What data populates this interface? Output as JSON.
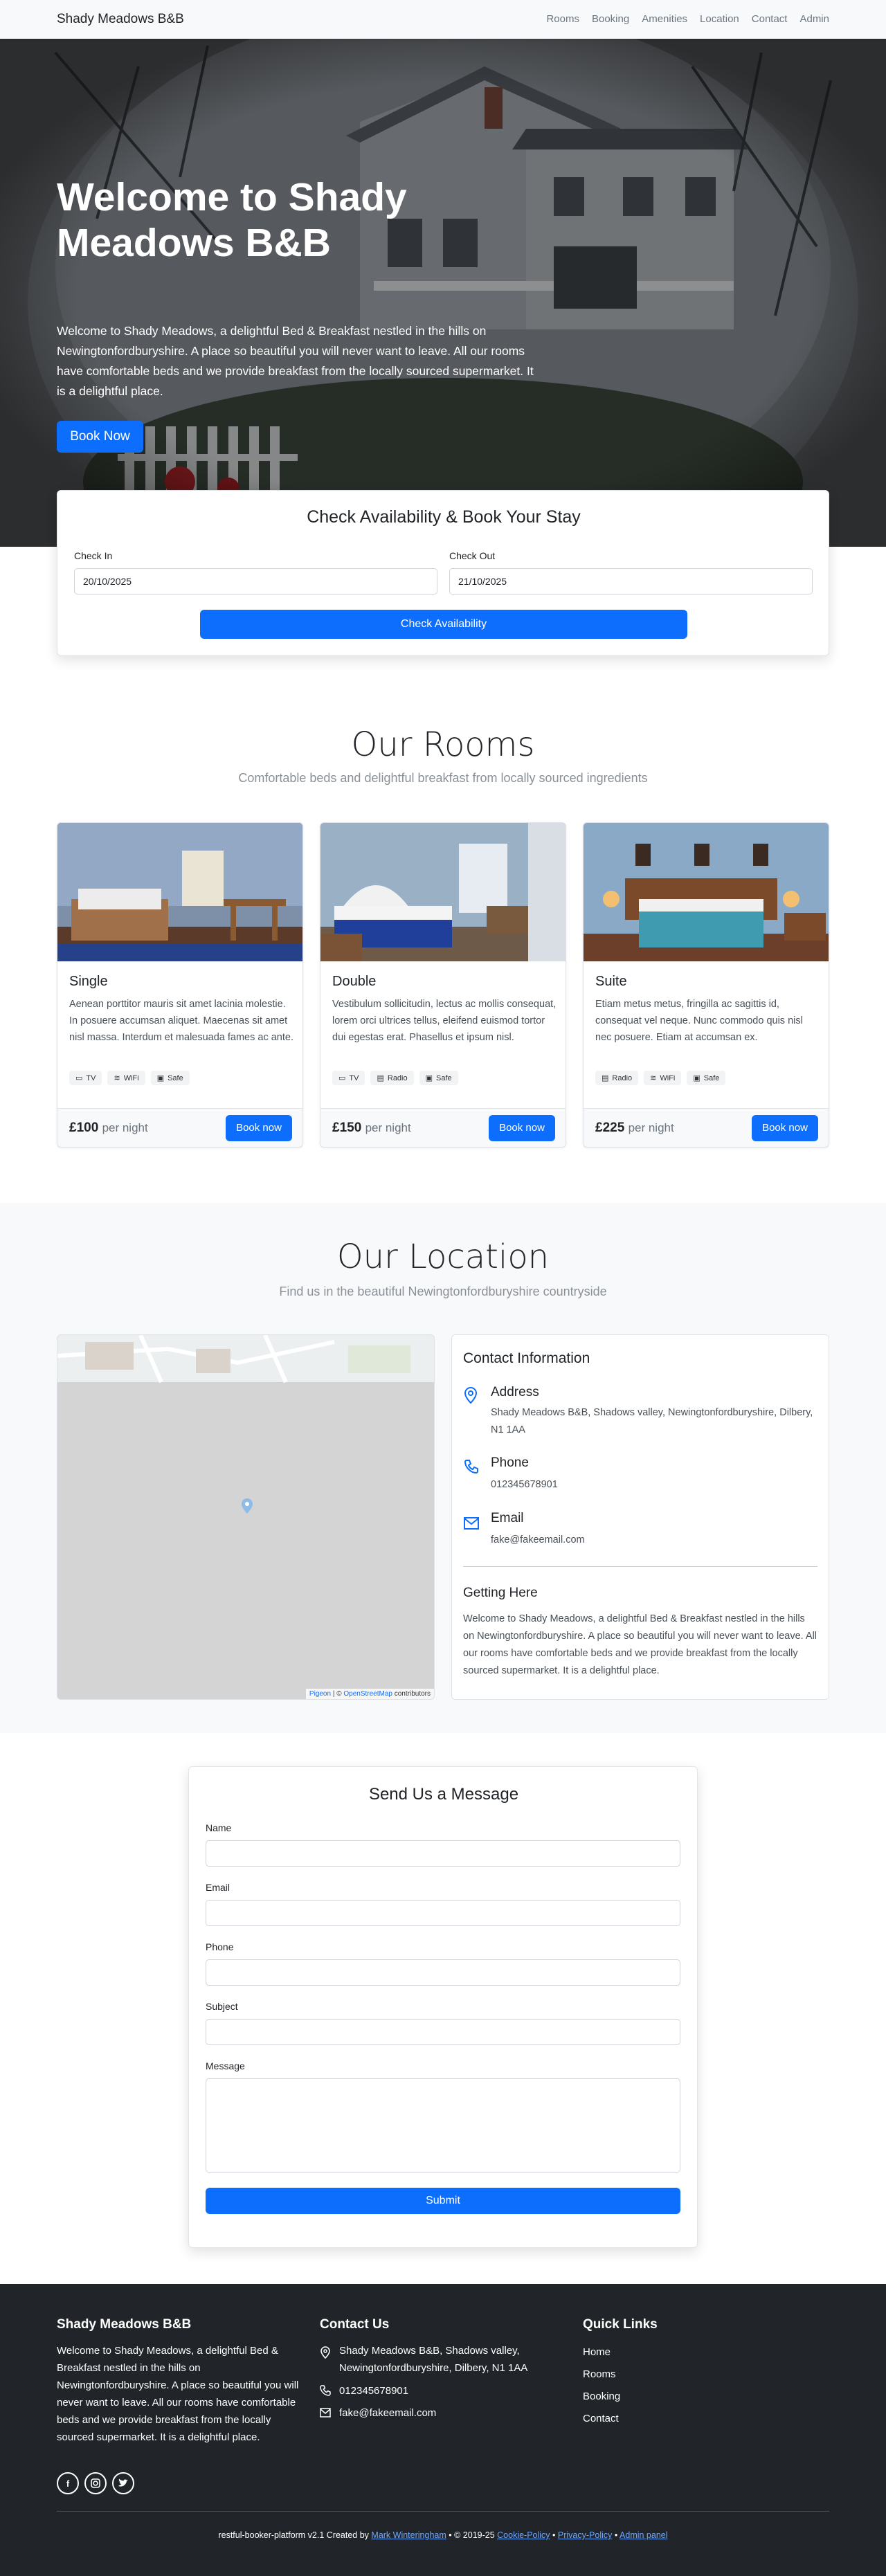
{
  "nav": {
    "brand": "Shady Meadows B&B",
    "links": [
      "Rooms",
      "Booking",
      "Amenities",
      "Location",
      "Contact",
      "Admin"
    ]
  },
  "hero": {
    "title": "Welcome to Shady Meadows B&B",
    "text": "Welcome to Shady Meadows, a delightful Bed & Breakfast nestled in the hills on Newingtonfordburyshire. A place so beautiful you will never want to leave. All our rooms have comfortable beds and we provide breakfast from the locally sourced supermarket. It is a delightful place.",
    "button": "Book Now"
  },
  "booking": {
    "title": "Check Availability & Book Your Stay",
    "checkin_label": "Check In",
    "checkin_value": "20/10/2025",
    "checkout_label": "Check Out",
    "checkout_value": "21/10/2025",
    "button": "Check Availability"
  },
  "rooms": {
    "title": "Our Rooms",
    "subtitle": "Comfortable beds and delightful breakfast from locally sourced ingredients",
    "items": [
      {
        "name": "Single",
        "desc": "Aenean porttitor mauris sit amet lacinia molestie. In posuere accumsan aliquet. Maecenas sit amet nisl massa. Interdum et malesuada fames ac ante.",
        "features": [
          "TV",
          "WiFi",
          "Safe"
        ],
        "price": "£100",
        "per": "per night",
        "button": "Book now"
      },
      {
        "name": "Double",
        "desc": "Vestibulum sollicitudin, lectus ac mollis consequat, lorem orci ultrices tellus, eleifend euismod tortor dui egestas erat. Phasellus et ipsum nisl.",
        "features": [
          "TV",
          "Radio",
          "Safe"
        ],
        "price": "£150",
        "per": "per night",
        "button": "Book now"
      },
      {
        "name": "Suite",
        "desc": "Etiam metus metus, fringilla ac sagittis id, consequat vel neque. Nunc commodo quis nisl nec posuere. Etiam at accumsan ex.",
        "features": [
          "Radio",
          "WiFi",
          "Safe"
        ],
        "price": "£225",
        "per": "per night",
        "button": "Book now"
      }
    ]
  },
  "location": {
    "title": "Our Location",
    "subtitle": "Find us in the beautiful Newingtonfordburyshire countryside",
    "map_attr_a": "Pigeon",
    "map_attr_sep": " | © ",
    "map_attr_b": "OpenStreetMap",
    "map_attr_c": " contributors",
    "contact_title": "Contact Information",
    "address_label": "Address",
    "address": "Shady Meadows B&B, Shadows valley, Newingtonfordburyshire, Dilbery, N1 1AA",
    "phone_label": "Phone",
    "phone": "012345678901",
    "email_label": "Email",
    "email": "fake@fakeemail.com",
    "getting_title": "Getting Here",
    "getting_text": "Welcome to Shady Meadows, a delightful Bed & Breakfast nestled in the hills on Newingtonfordburyshire. A place so beautiful you will never want to leave. All our rooms have comfortable beds and we provide breakfast from the locally sourced supermarket. It is a delightful place."
  },
  "contact_form": {
    "title": "Send Us a Message",
    "name_label": "Name",
    "email_label": "Email",
    "phone_label": "Phone",
    "subject_label": "Subject",
    "message_label": "Message",
    "button": "Submit"
  },
  "footer": {
    "brand": "Shady Meadows B&B",
    "about": "Welcome to Shady Meadows, a delightful Bed & Breakfast nestled in the hills on Newingtonfordburyshire. A place so beautiful you will never want to leave. All our rooms have comfortable beds and we provide breakfast from the locally sourced supermarket. It is a delightful place.",
    "contact_title": "Contact Us",
    "address": "Shady Meadows B&B, Shadows valley, Newingtonfordburyshire, Dilbery, N1 1AA",
    "phone": "012345678901",
    "email": "fake@fakeemail.com",
    "links_title": "Quick Links",
    "links": [
      "Home",
      "Rooms",
      "Booking",
      "Contact"
    ],
    "copy_a": "restful-booker-platform v2.1 Created by ",
    "copy_author": "Mark Winteringham",
    "copy_b": " • © 2019-25 ",
    "copy_cookie": "Cookie-Policy",
    "copy_sep1": " • ",
    "copy_privacy": "Privacy-Policy",
    "copy_sep2": " • ",
    "copy_admin": "Admin panel"
  },
  "colors": {
    "primary": "#0d6efd",
    "footer_bg": "#212529",
    "section_bg": "#f8f9fa"
  }
}
